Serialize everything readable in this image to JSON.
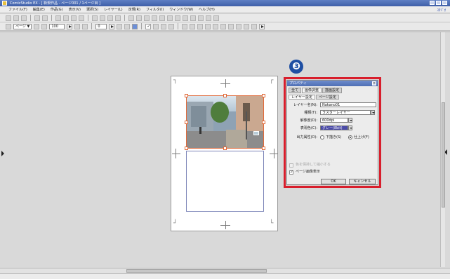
{
  "window": {
    "title": "ComicStudio EX - [ 新規作品 - ページ001 / 1ページ目 ]",
    "title_right": "ｽﾀｼﾞｵ"
  },
  "menu": [
    "ファイル(F)",
    "編集(E)",
    "作品(G)",
    "表示(V)",
    "選択(S)",
    "レイヤー(L)",
    "定規(R)",
    "フィルタ(I)",
    "ウィンドウ(W)",
    "ヘルプ(H)"
  ],
  "toolbar2": {
    "view_field": "100",
    "page_field": "ページ ▼",
    "angle_field": "0"
  },
  "badge": "❸",
  "properties": {
    "title": "プロパティ",
    "close": "×",
    "tabs": [
      "全て",
      "画像調整",
      "描画設定"
    ],
    "subtabs": [
      "レイヤー設定",
      "ページ設定"
    ],
    "layer_name_label": "レイヤー名(N):",
    "layer_name_value": "Nakano01",
    "type_label": "種類(T):",
    "type_value": "ラスターレイヤー",
    "resolution_label": "解像度(D):",
    "resolution_value": "600dpi",
    "expression_label": "表現色(C):",
    "expression_value": "グレー(8bit)",
    "output_label": "出力属性(O):",
    "output_option_1": "下描き(S)",
    "output_option_2": "仕上げ(F)",
    "check_disabled_label": "色を保持して縮小する",
    "check_on_label": "ページ画像表示",
    "ok_label": "OK",
    "cancel_label": "キャンセル"
  }
}
